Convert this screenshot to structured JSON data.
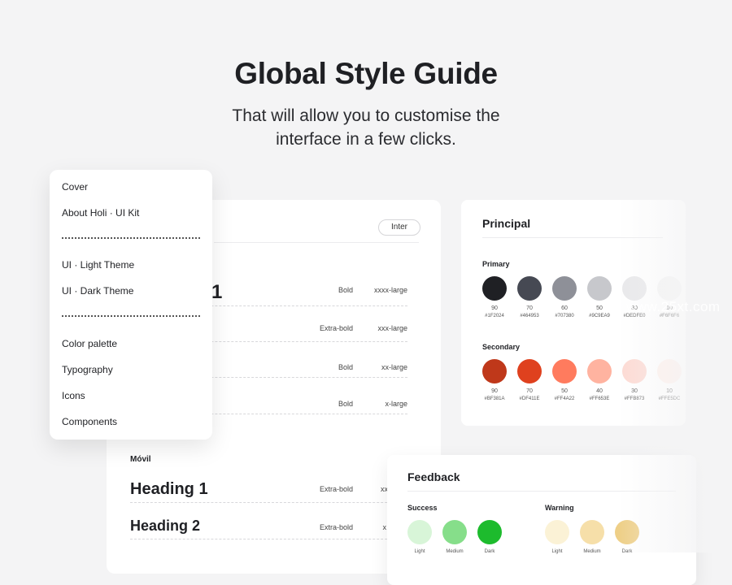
{
  "hero": {
    "title": "Global Style Guide",
    "subtitle_line1": "That will allow you to customise the",
    "subtitle_line2": "interface in a few clicks."
  },
  "nav": {
    "items": [
      {
        "label": "Cover"
      },
      {
        "label": "About Holi · UI Kit"
      },
      {
        "label": "UI · Light Theme"
      },
      {
        "label": "UI · Dark Theme"
      },
      {
        "label": "Color palette"
      },
      {
        "label": "Typography"
      },
      {
        "label": "Icons"
      },
      {
        "label": "Components"
      }
    ]
  },
  "typography": {
    "font_pill": "Inter",
    "partial_heading": "1",
    "desktop_rows": [
      {
        "weight": "Bold",
        "size": "xxxx-large"
      },
      {
        "weight": "Extra-bold",
        "size": "xxx-large"
      },
      {
        "weight": "Bold",
        "size": "xx-large"
      },
      {
        "weight": "Bold",
        "size": "x-large"
      }
    ],
    "movil_label": "Móvil",
    "movil_rows": [
      {
        "sample": "Heading 1",
        "weight": "Extra-bold",
        "size": "xx"
      },
      {
        "sample": "Heading 2",
        "weight": "Extra-bold",
        "size": "x"
      }
    ]
  },
  "principal": {
    "title": "Principal",
    "primary_label": "Primary",
    "primary": [
      {
        "num": "90",
        "hex": "#1F2024",
        "color": "#1F2024"
      },
      {
        "num": "70",
        "hex": "#464953",
        "color": "#464953"
      },
      {
        "num": "60",
        "hex": "#707380",
        "color": "#8E9098"
      },
      {
        "num": "50",
        "hex": "#9C9EA9",
        "color": "#C7C8CC"
      },
      {
        "num": "30",
        "hex": "#DEDFE0",
        "color": "#E8E8EA"
      },
      {
        "num": "10",
        "hex": "#F6F6F6",
        "color": "#F3F3F4"
      }
    ],
    "secondary_label": "Secondary",
    "secondary": [
      {
        "num": "90",
        "hex": "#BF381A",
        "color": "#BF381A"
      },
      {
        "num": "70",
        "hex": "#DF411E",
        "color": "#DF411E"
      },
      {
        "num": "50",
        "hex": "#FF4A22",
        "color": "#FF7B5E"
      },
      {
        "num": "40",
        "hex": "#FF653E",
        "color": "#FFB3A0"
      },
      {
        "num": "30",
        "hex": "#FFB873",
        "color": "#FDDAD3"
      },
      {
        "num": "10",
        "hex": "#FFE5DC",
        "color": "#FFF0EB"
      }
    ]
  },
  "feedback": {
    "title": "Feedback",
    "success_label": "Success",
    "success": [
      {
        "cap": "Light",
        "color": "#D8F5D8"
      },
      {
        "cap": "Medium",
        "color": "#86DE8A"
      },
      {
        "cap": "Dark",
        "color": "#1DBB2D"
      }
    ],
    "warning_label": "Warning",
    "warning": [
      {
        "cap": "Light",
        "color": "#FBF2D6"
      },
      {
        "cap": "Medium",
        "color": "#F6DFA9"
      },
      {
        "cap": "Dark",
        "color": "#EECF87"
      }
    ]
  },
  "watermark": "www.25xt.com"
}
